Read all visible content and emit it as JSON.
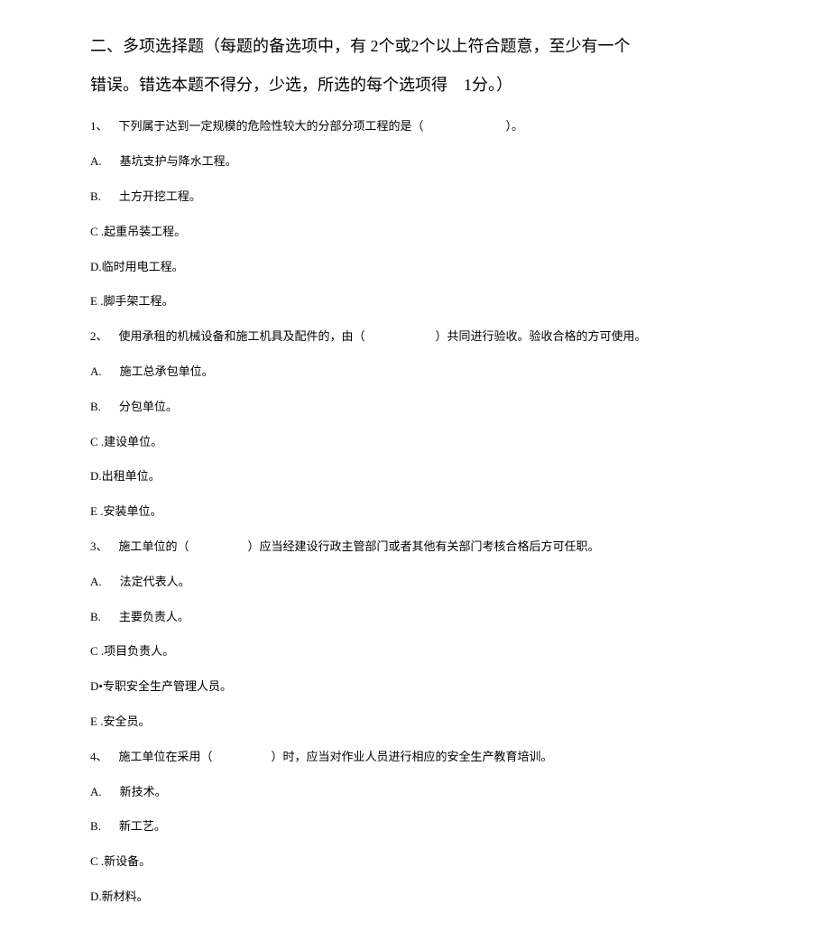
{
  "section": {
    "title_line1": "二、多项选择题（每题的备选项中，有 2个或2个以上符合题意，至少有一个",
    "title_line2": "错误。错选本题不得分，少选，所选的每个选项得　1分。）"
  },
  "questions": [
    {
      "num": "1、",
      "stem": "下列属于达到一定规模的危险性较大的分部分项工程的是（　　　　　　　）。",
      "options": [
        {
          "label": "A.",
          "text": "基坑支护与降水工程。",
          "spaced": true
        },
        {
          "label": "B.",
          "text": "土方开挖工程。",
          "spaced": true
        },
        {
          "label": "C .",
          "text": "起重吊装工程。",
          "spaced": false
        },
        {
          "label": "D.",
          "text": "临时用电工程。",
          "spaced": false
        },
        {
          "label": "E .",
          "text": "脚手架工程。",
          "spaced": false
        }
      ]
    },
    {
      "num": "2、",
      "stem": "使用承租的机械设备和施工机具及配件的，由（　　　　　　）共同进行验收。验收合格的方可使用。",
      "options": [
        {
          "label": "A.",
          "text": "施工总承包单位。",
          "spaced": true
        },
        {
          "label": "B.",
          "text": "分包单位。",
          "spaced": true
        },
        {
          "label": "C .",
          "text": "建设单位。",
          "spaced": false
        },
        {
          "label": "D.",
          "text": "出租单位。",
          "spaced": false
        },
        {
          "label": "E .",
          "text": "安装单位。",
          "spaced": false
        }
      ]
    },
    {
      "num": "3、",
      "stem": "施工单位的（　　　　　）应当经建设行政主管部门或者其他有关部门考核合格后方可任职。",
      "options": [
        {
          "label": "A.",
          "text": "法定代表人。",
          "spaced": true
        },
        {
          "label": "B.",
          "text": "主要负责人。",
          "spaced": true
        },
        {
          "label": "C .",
          "text": "项目负责人。",
          "spaced": false
        },
        {
          "label": "D•",
          "text": "专职安全生产管理人员。",
          "spaced": false
        },
        {
          "label": "E .",
          "text": "安全员。",
          "spaced": false
        }
      ]
    },
    {
      "num": "4、",
      "stem": "施工单位在采用（　　　　　）时，应当对作业人员进行相应的安全生产教育培训。",
      "options": [
        {
          "label": "A.",
          "text": "新技术。",
          "spaced": true
        },
        {
          "label": "B.",
          "text": "新工艺。",
          "spaced": true
        },
        {
          "label": "C .",
          "text": "新设备。",
          "spaced": false
        },
        {
          "label": "D.",
          "text": "新材料。",
          "spaced": false
        }
      ]
    }
  ]
}
